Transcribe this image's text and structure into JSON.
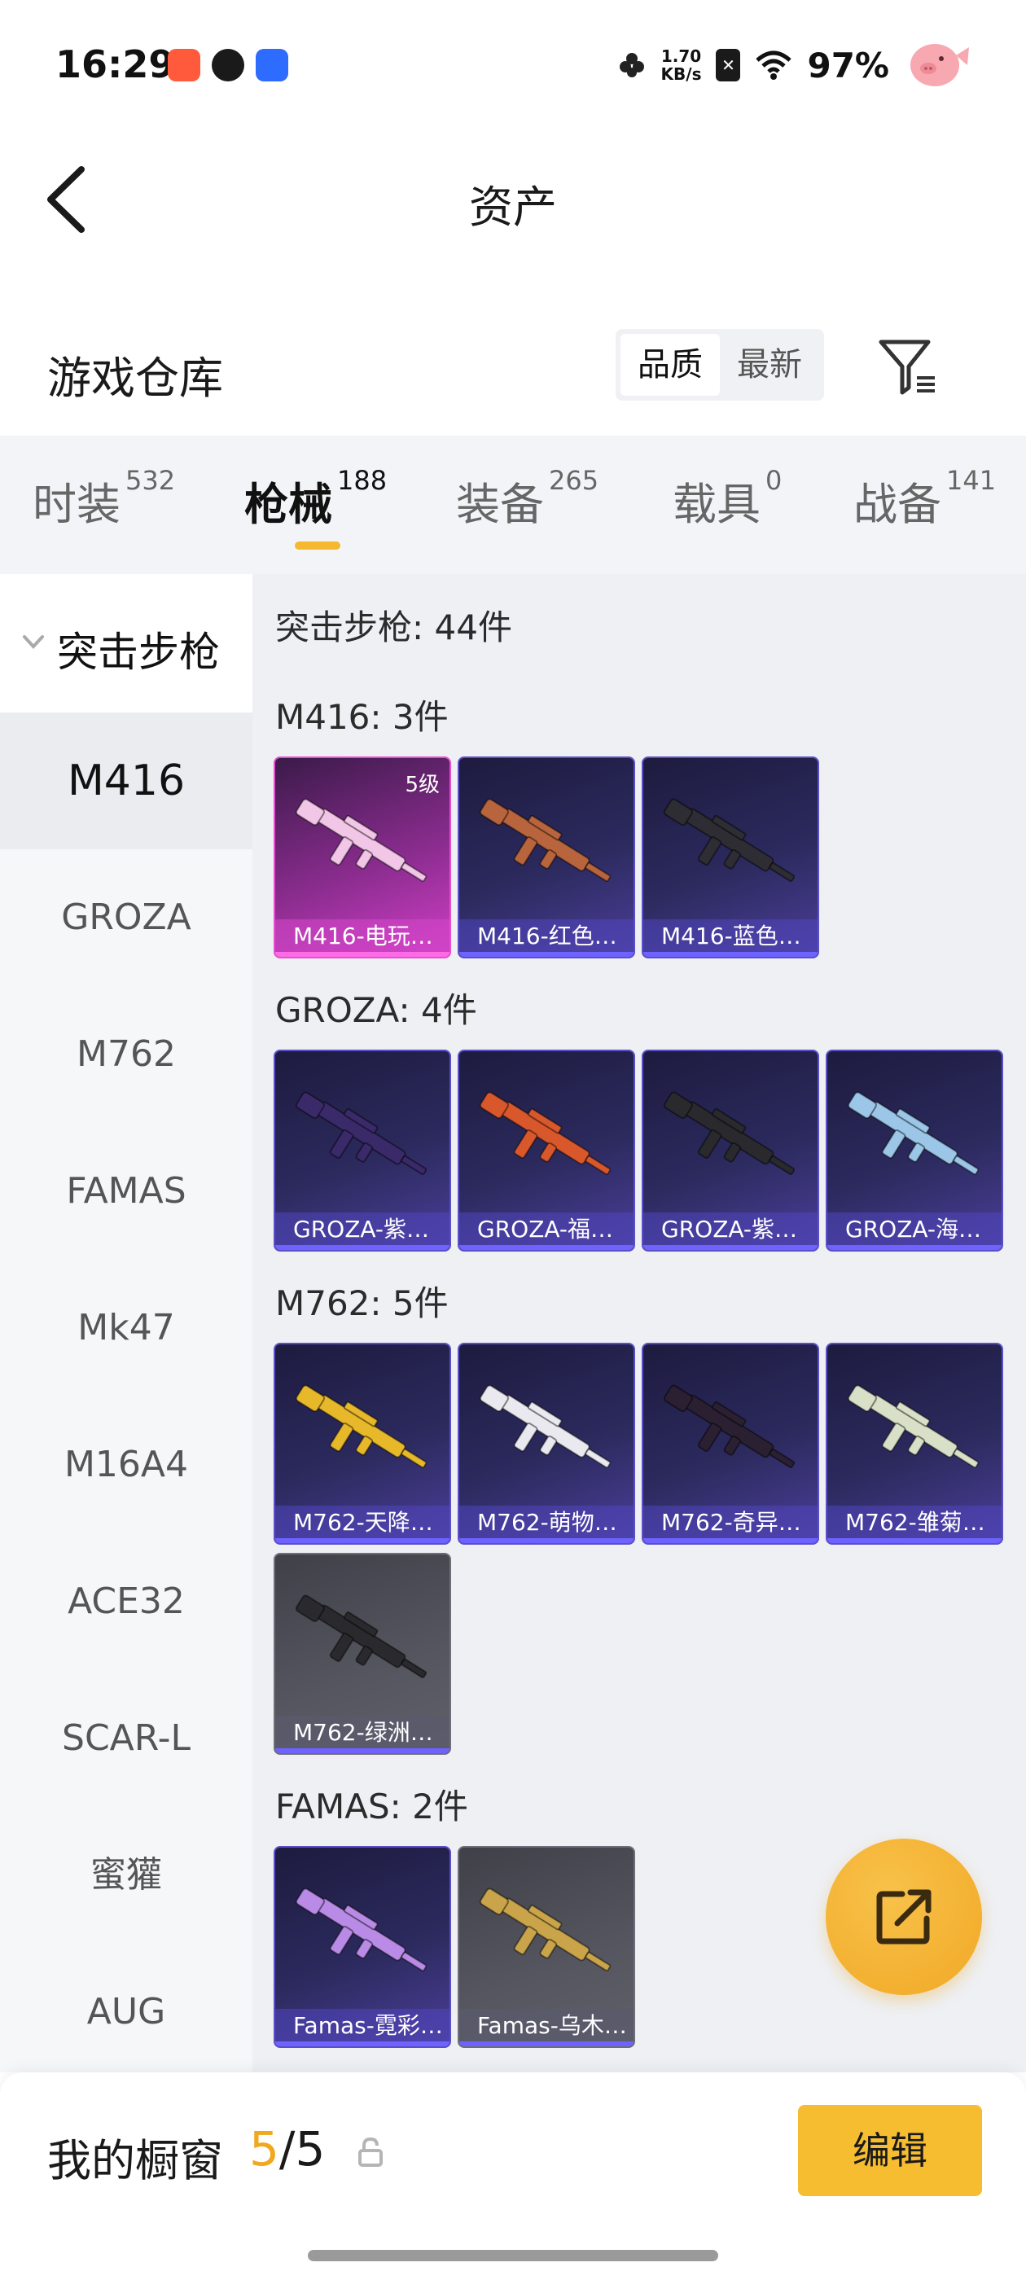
{
  "status_bar": {
    "time": "16:29",
    "net_speed_value": "1.70",
    "net_speed_unit": "KB/s",
    "battery": "97%",
    "icons": [
      "app-icon-1",
      "app-icon-2",
      "app-icon-3",
      "flower-icon",
      "sim-icon",
      "wifi-icon",
      "pig-avatar-icon"
    ]
  },
  "header": {
    "title": "资产"
  },
  "warehouse": {
    "title": "游戏仓库",
    "sort_options": [
      "品质",
      "最新"
    ],
    "active_sort": "品质"
  },
  "tabs": [
    {
      "label": "时装",
      "count": "532"
    },
    {
      "label": "枪械",
      "count": "188"
    },
    {
      "label": "装备",
      "count": "265"
    },
    {
      "label": "载具",
      "count": "0"
    },
    {
      "label": "战备",
      "count": "141"
    }
  ],
  "sidebar": {
    "group": "突击步枪",
    "items": [
      "M416",
      "GROZA",
      "M762",
      "FAMAS",
      "Mk47",
      "M16A4",
      "ACE32",
      "SCAR-L",
      "蜜獾",
      "AUG"
    ],
    "active": "M416"
  },
  "content": {
    "summary": "突击步枪: 44件",
    "sections": [
      {
        "title": "M416: 3件",
        "items": [
          {
            "name": "M416-电玩…",
            "level": "5级",
            "style": "pink",
            "gun_color": "#f2c6e6"
          },
          {
            "name": "M416-红色…",
            "level": "",
            "style": "purple",
            "gun_color": "#b8643d"
          },
          {
            "name": "M416-蓝色…",
            "level": "",
            "style": "purple",
            "gun_color": "#2d2d33"
          }
        ]
      },
      {
        "title": "GROZA: 4件",
        "items": [
          {
            "name": "GROZA-紫…",
            "style": "purple",
            "gun_color": "#3b2a6a"
          },
          {
            "name": "GROZA-福…",
            "style": "purple",
            "gun_color": "#d9582b"
          },
          {
            "name": "GROZA-紫…",
            "style": "purple",
            "gun_color": "#2a2a2e"
          },
          {
            "name": "GROZA-海…",
            "style": "purple",
            "gun_color": "#9cc6e8"
          }
        ]
      },
      {
        "title": "M762: 5件",
        "items": [
          {
            "name": "M762-天降…",
            "style": "purple",
            "gun_color": "#e8b82b"
          },
          {
            "name": "M762-萌物…",
            "style": "purple",
            "gun_color": "#e9e9ef"
          },
          {
            "name": "M762-奇异…",
            "style": "purple",
            "gun_color": "#2b2032"
          },
          {
            "name": "M762-雏菊…",
            "style": "purple",
            "gun_color": "#d9e0c8"
          },
          {
            "name": "M762-绿洲…",
            "style": "gray",
            "gun_color": "#2a2a2e"
          }
        ]
      },
      {
        "title": "FAMAS: 2件",
        "items": [
          {
            "name": "Famas-霓彩…",
            "style": "purple",
            "gun_color": "#b98be6"
          },
          {
            "name": "Famas-乌木…",
            "style": "gray",
            "gun_color": "#c9a44a"
          }
        ]
      }
    ]
  },
  "showcase": {
    "title": "我的橱窗",
    "used": "5",
    "separator": "/",
    "total": "5",
    "edit_label": "编辑"
  },
  "colors": {
    "accent": "#f5bd2f",
    "tab_underline": "#f5b82e"
  }
}
